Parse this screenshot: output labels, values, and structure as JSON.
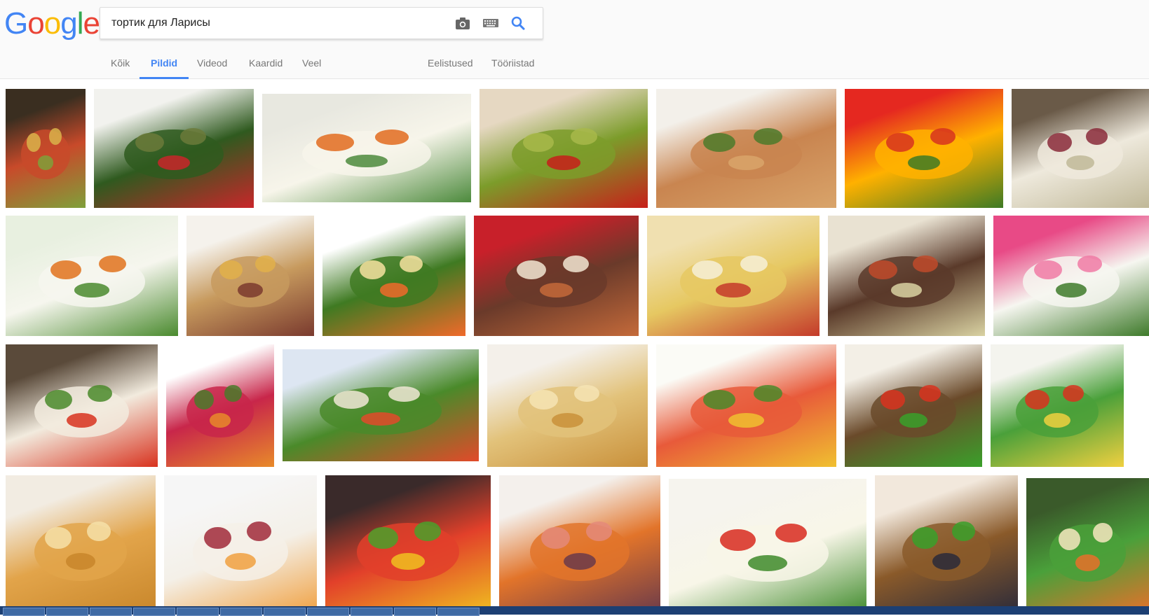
{
  "logo": {
    "letters": [
      "G",
      "o",
      "o",
      "g",
      "l",
      "e"
    ],
    "colors": [
      "#4285f4",
      "#ea4335",
      "#fbbc05",
      "#4285f4",
      "#34a853",
      "#ea4335"
    ]
  },
  "search": {
    "query": "тортик для Ларисы"
  },
  "icons": {
    "camera": "camera-icon",
    "keyboard": "keyboard-icon",
    "search": "search-icon"
  },
  "tabs": [
    {
      "label": "Kõik",
      "active": false
    },
    {
      "label": "Pildid",
      "active": true
    },
    {
      "label": "Videod",
      "active": false
    },
    {
      "label": "Kaardid",
      "active": false
    },
    {
      "label": "Veel",
      "active": false
    }
  ],
  "tools": {
    "settings": "Eelistused",
    "tools": "Tööriistad"
  },
  "accent": "#4285f4",
  "results": [
    {
      "row": 0,
      "colors": [
        "#3a2e20",
        "#c84a2a",
        "#7fa03a",
        "#d9b34a"
      ]
    },
    {
      "row": 0,
      "colors": [
        "#f2f2ee",
        "#2f5a1f",
        "#c9262a",
        "#6b7a3a"
      ]
    },
    {
      "row": 0,
      "colors": [
        "#e8e8e0",
        "#f7f5ea",
        "#4c8a3c",
        "#e26b1e"
      ]
    },
    {
      "row": 0,
      "colors": [
        "#e6d8c2",
        "#7c9c2a",
        "#c71f1a",
        "#a8b84a"
      ]
    },
    {
      "row": 0,
      "colors": [
        "#f3f0ea",
        "#c98550",
        "#d9a46a",
        "#4c7a2a"
      ]
    },
    {
      "row": 0,
      "colors": [
        "#e52820",
        "#ffb100",
        "#3d7a24",
        "#d7321e"
      ]
    },
    {
      "row": 0,
      "colors": [
        "#6a5a48",
        "#eee9dc",
        "#c0b898",
        "#8a2a3a"
      ]
    },
    {
      "row": 1,
      "colors": [
        "#e8f0e0",
        "#f6f6ee",
        "#4a8a2e",
        "#e0721c"
      ]
    },
    {
      "row": 1,
      "colors": [
        "#f5f2ec",
        "#c79a5e",
        "#7a3a2e",
        "#e2b04a"
      ]
    },
    {
      "row": 1,
      "colors": [
        "#ffffff",
        "#3f7a22",
        "#f06a2a",
        "#f6e2a0"
      ]
    },
    {
      "row": 1,
      "colors": [
        "#c8202a",
        "#6a3a2a",
        "#c46a3a",
        "#f2e6d2"
      ]
    },
    {
      "row": 1,
      "colors": [
        "#f0e0b0",
        "#e6c862",
        "#c43a2a",
        "#f6f0d8"
      ]
    },
    {
      "row": 1,
      "colors": [
        "#e9e2d2",
        "#5a3a2a",
        "#d9d2a2",
        "#c04a2a"
      ]
    },
    {
      "row": 1,
      "colors": [
        "#e84a86",
        "#f6f6f0",
        "#3e7a2a",
        "#f07aa4"
      ]
    },
    {
      "row": 2,
      "colors": [
        "#5a4a3a",
        "#f2ebde",
        "#d8321e",
        "#4a8a2a"
      ]
    },
    {
      "row": 2,
      "colors": [
        "#ffffff",
        "#c8264a",
        "#e88a2a",
        "#4a7a2a"
      ]
    },
    {
      "row": 2,
      "colors": [
        "#dde6f2",
        "#4a8a2a",
        "#e24a2a",
        "#f0e8d6"
      ]
    },
    {
      "row": 2,
      "colors": [
        "#f4f0ea",
        "#e2c27a",
        "#c9903a",
        "#f6e4b4"
      ]
    },
    {
      "row": 2,
      "colors": [
        "#fbfbf6",
        "#e85a3a",
        "#f0c030",
        "#4a8a2a"
      ]
    },
    {
      "row": 2,
      "colors": [
        "#f3efe6",
        "#6a4a2a",
        "#3aa02a",
        "#d8321e"
      ]
    },
    {
      "row": 2,
      "colors": [
        "#f4f4ee",
        "#4aa03a",
        "#f0d040",
        "#d8321e"
      ]
    },
    {
      "row": 3,
      "colors": [
        "#f2ece2",
        "#e2a44a",
        "#c8862a",
        "#f6e0a8"
      ]
    },
    {
      "row": 3,
      "colors": [
        "#f6f6f6",
        "#f4f0e8",
        "#f0a040",
        "#a02a3a"
      ]
    },
    {
      "row": 3,
      "colors": [
        "#3a2a2a",
        "#e2402a",
        "#f0c020",
        "#4aa02a"
      ]
    },
    {
      "row": 3,
      "colors": [
        "#f4f0ec",
        "#e2742a",
        "#6a3a4a",
        "#e48a7a"
      ]
    },
    {
      "row": 3,
      "colors": [
        "#f6f4ee",
        "#f8f6e8",
        "#3e8a2a",
        "#d82a1e"
      ]
    },
    {
      "row": 3,
      "colors": [
        "#f2e8dc",
        "#8a5a2a",
        "#2a2a3a",
        "#3aa02a"
      ]
    },
    {
      "row": 3,
      "colors": [
        "#3a5a2a",
        "#4aa03a",
        "#e8702a",
        "#f6e6c0"
      ]
    }
  ]
}
